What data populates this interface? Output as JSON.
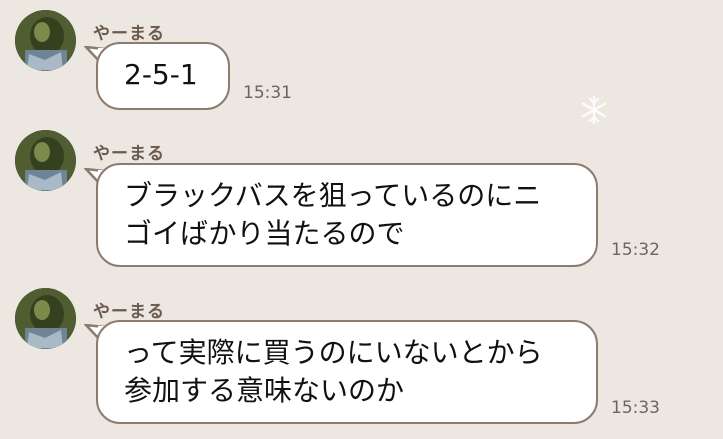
{
  "messages": [
    {
      "sender": "やーまる",
      "lines": [
        "2-5-1"
      ],
      "time": "15:31"
    },
    {
      "sender": "やーまる",
      "lines": [
        "ブラックバスを狙っているのにニ",
        "ゴイばかり当たるので"
      ],
      "time": "15:32"
    },
    {
      "sender": "やーまる",
      "lines": [
        "って実際に買うのにいないとから",
        "参加する意味ないのか"
      ],
      "time": "15:33"
    }
  ],
  "colors": {
    "background": "#ede7e1",
    "bubble_border": "#8d7b6e",
    "sender_text": "#6b5a4e",
    "time_text": "#6e6460"
  },
  "icons": [
    "avatar-photo",
    "snowflake-icon"
  ]
}
